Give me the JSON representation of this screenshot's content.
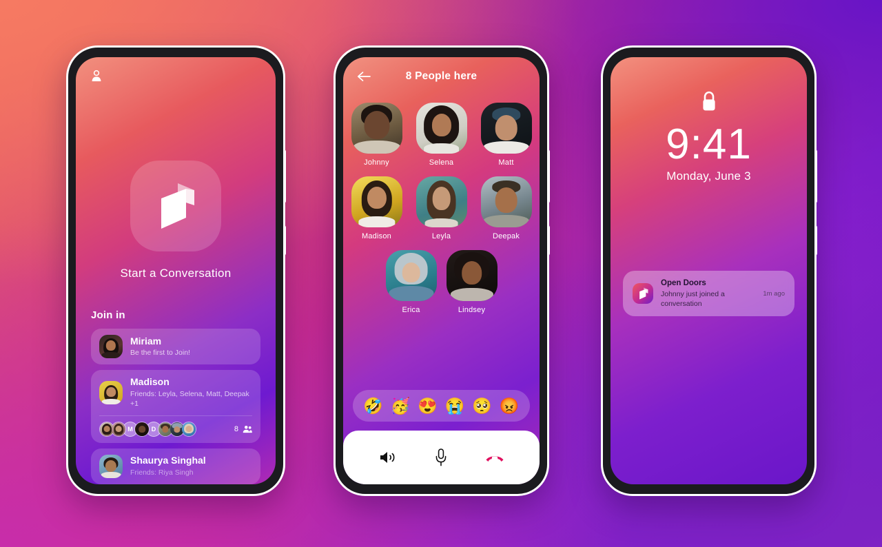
{
  "background": {
    "colors": [
      "#f67a62",
      "#c52a8f",
      "#8e22cd",
      "#6814c6"
    ]
  },
  "phone1": {
    "name": "home-screen",
    "profile_icon": "person-icon",
    "logo_icon": "open-doors-logo",
    "hero_label": "Start a Conversation",
    "join_in": {
      "title": "Join in",
      "cards": [
        {
          "name": "Miriam",
          "subtitle": "Be the first to Join!",
          "avatar_color": "#6b3030"
        },
        {
          "name": "Madison",
          "subtitle": "Friends: Leyla, Selena, Matt, Deepak +1",
          "avatar_color": "#d9b52a",
          "stack": [
            {
              "type": "photo",
              "color": "#7a4636"
            },
            {
              "type": "photo",
              "color": "#9a6a4e"
            },
            {
              "type": "letter",
              "label": "M"
            },
            {
              "type": "photo",
              "color": "#2a1a16"
            },
            {
              "type": "letter",
              "label": "D"
            },
            {
              "type": "photo",
              "color": "#6d7b64"
            },
            {
              "type": "photo",
              "color": "#3c4a58"
            },
            {
              "type": "photo",
              "color": "#4a86c8"
            }
          ],
          "count": "8",
          "count_icon": "people-icon"
        },
        {
          "name": "Shaurya Singhal",
          "subtitle": "Friends: Riya Singh",
          "avatar_color": "#5f88a8"
        }
      ]
    }
  },
  "phone2": {
    "name": "conversation-room",
    "back_icon": "back-arrow-icon",
    "title": "8 People here",
    "people": [
      [
        {
          "name": "Johnny",
          "bg": "#7e6b52",
          "skin": "#6b4630",
          "hair": "#23170f",
          "shirt": "#cfc6b6"
        },
        {
          "name": "Selena",
          "bg": "#dcdcd6",
          "skin": "#b07a55",
          "hair": "#1d1411",
          "shirt": "#e8e6e0"
        },
        {
          "name": "Matt",
          "bg": "#151a1e",
          "skin": "#c08f6e",
          "hair": "#2f3d4a",
          "shirt": "#eceae6"
        }
      ],
      [
        {
          "name": "Madison",
          "bg": "#d9b52a",
          "skin": "#c08a62",
          "hair": "#2a1c12",
          "shirt": "#f0ece6"
        },
        {
          "name": "Leyla",
          "bg": "#4e8f92",
          "skin": "#c69a78",
          "hair": "#3d2a1d",
          "shirt": "#dcd6cc"
        },
        {
          "name": "Deepak",
          "bg": "#8a9aa0",
          "skin": "#a5704a",
          "hair": "#3a3024",
          "shirt": "#9a9c92"
        }
      ],
      [
        {
          "name": "Erica",
          "bg": "#2f8b97",
          "skin": "#dcb89c",
          "hair": "#b9c6cc",
          "shirt": "#5e89a6"
        },
        {
          "name": "Lindsey",
          "bg": "#14100f",
          "skin": "#8a5838",
          "hair": "#1a1210",
          "shirt": "#cfc8c0"
        }
      ]
    ],
    "reactions": [
      "🤣",
      "🥳",
      "😍",
      "😭",
      "🥺",
      "😡"
    ],
    "controls": [
      {
        "name": "speaker-button",
        "icon": "speaker-icon"
      },
      {
        "name": "microphone-button",
        "icon": "microphone-icon"
      },
      {
        "name": "end-call-button",
        "icon": "end-call-icon"
      }
    ]
  },
  "phone3": {
    "name": "lock-screen",
    "lock_icon": "lock-icon",
    "time": "9:41",
    "date": "Monday, June 3",
    "notification": {
      "app": "Open Doors",
      "message": "Johnny just joined a conversation",
      "time": "1m ago",
      "icon": "open-doors-logo"
    }
  }
}
